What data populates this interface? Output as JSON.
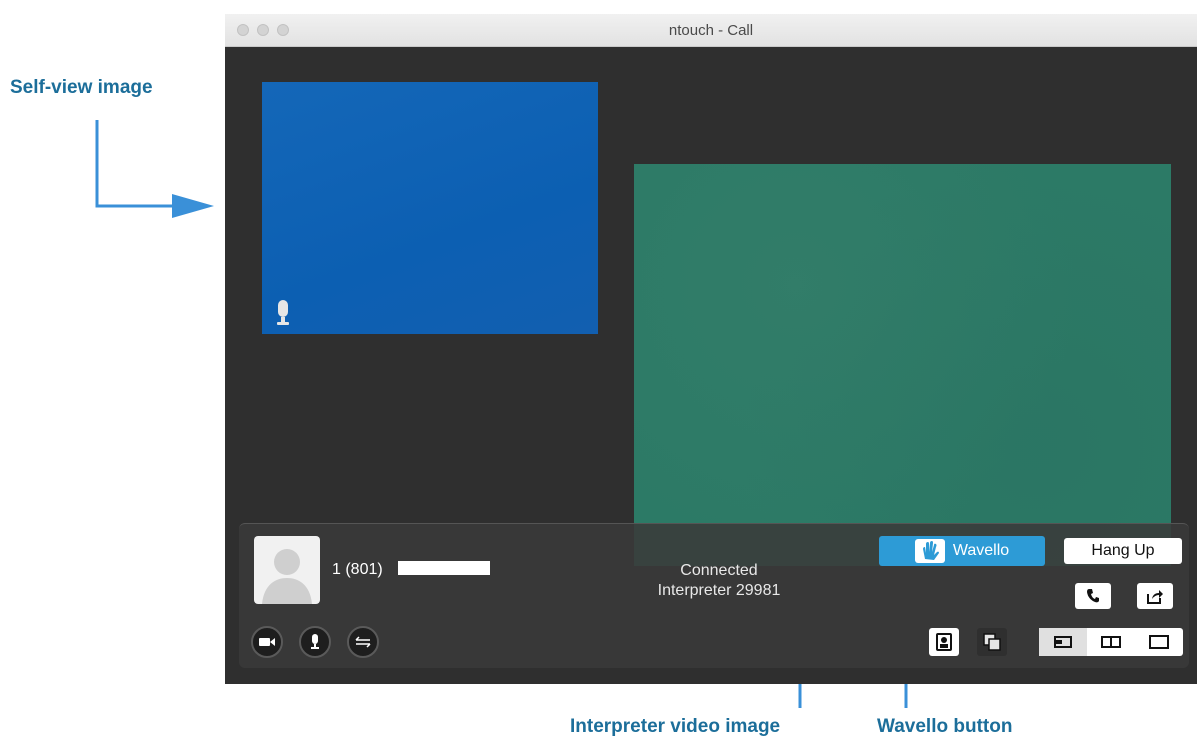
{
  "callouts": {
    "self_view": "Self-view image",
    "interpreter_video": "Interpreter video image",
    "wavello_button": "Wavello button"
  },
  "window": {
    "title": "ntouch - Call"
  },
  "call": {
    "number_prefix": "1 (801)",
    "status_line1": "Connected",
    "status_line2": "Interpreter 29981"
  },
  "controls": {
    "wavello_label": "Wavello",
    "hangup_label": "Hang Up"
  },
  "colors": {
    "accent": "#2d9bd6",
    "callout_text": "#1c6e9a",
    "arrow": "#3a90d8",
    "self_view": "#0f62b6",
    "remote_video": "#2c7a66"
  },
  "icons": {
    "mic_indicator": "microphone-icon",
    "phone": "phone-icon",
    "share": "share-icon",
    "camera": "video-camera-icon",
    "mic": "microphone-icon",
    "swap": "swap-arrows-icon",
    "selfview_toggle": "self-view-icon",
    "pip": "picture-in-picture-icon",
    "layout_small": "layout-small-icon",
    "layout_split": "layout-split-icon",
    "layout_full": "layout-full-icon"
  }
}
